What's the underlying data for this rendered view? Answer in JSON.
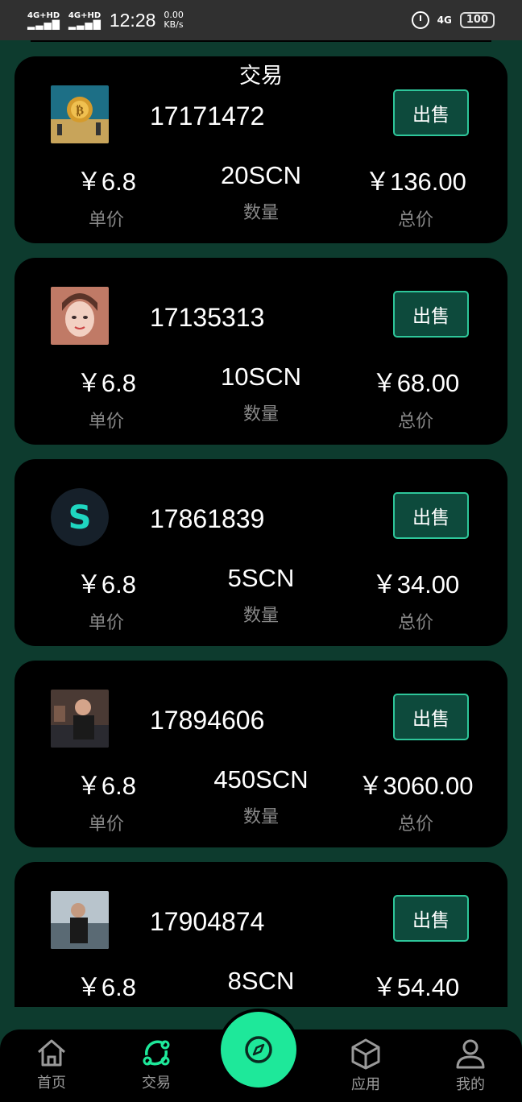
{
  "status_bar": {
    "signal1": "4G+HD",
    "signal2": "4G+HD",
    "time": "12:28",
    "net_speed": "0.00",
    "net_unit": "KB/s",
    "network": "4G",
    "battery": "100"
  },
  "page_title": "交易",
  "labels": {
    "sell": "出售",
    "unit_price": "单价",
    "quantity": "数量",
    "total": "总价"
  },
  "orders": [
    {
      "uid": "17171472",
      "price": "￥6.8",
      "qty": "20SCN",
      "total": "￥136.00",
      "avatar": "bitcoin"
    },
    {
      "uid": "17135313",
      "price": "￥6.8",
      "qty": "10SCN",
      "total": "￥68.00",
      "avatar": "woman"
    },
    {
      "uid": "17861839",
      "price": "￥6.8",
      "qty": "5SCN",
      "total": "￥34.00",
      "avatar": "s-logo"
    },
    {
      "uid": "17894606",
      "price": "￥6.8",
      "qty": "450SCN",
      "total": "￥3060.00",
      "avatar": "man-office"
    },
    {
      "uid": "17904874",
      "price": "￥6.8",
      "qty": "8SCN",
      "total": "￥54.40",
      "avatar": "man-outdoor"
    }
  ],
  "tabbar": {
    "home": "首页",
    "trade": "交易",
    "apps": "应用",
    "mine": "我的",
    "accent_color": "#1ee89a",
    "icons": [
      "home-icon",
      "trade-icon",
      "compass-icon",
      "cube-icon",
      "user-icon"
    ]
  }
}
